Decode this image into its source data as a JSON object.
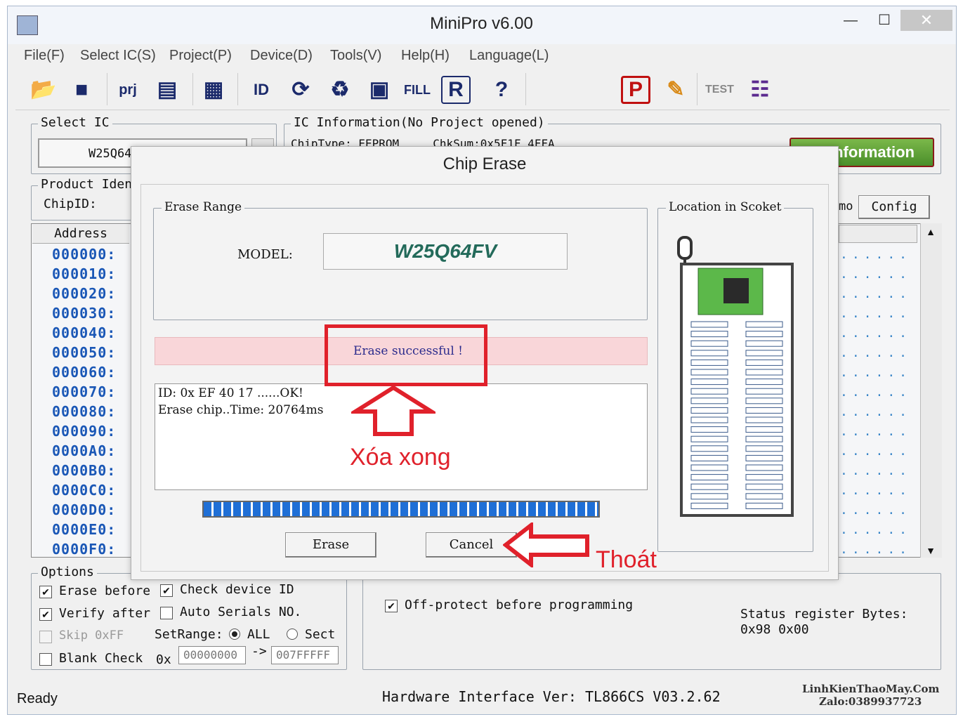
{
  "window": {
    "title": "MiniPro v6.00",
    "minimize_glyph": "—",
    "maximize_glyph": "☐",
    "close_glyph": "✕"
  },
  "menu": [
    "File(F)",
    "Select IC(S)",
    "Project(P)",
    "Device(D)",
    "Tools(V)",
    "Help(H)",
    "Language(L)"
  ],
  "toolbar_icons": [
    "open-folder-icon",
    "save-icon",
    "open-project-icon",
    "save-project-icon",
    "chip-list-icon",
    "read-id-icon",
    "read-icon",
    "verify-icon",
    "blank-check-icon",
    "fill-icon",
    "read-chip-icon",
    "help-icon",
    "program-icon",
    "edit-icon",
    "test-icon",
    "socket-icon"
  ],
  "select_ic": {
    "label": "Select IC",
    "value": "W25Q64"
  },
  "ic_info": {
    "label": "IC Information(No Project opened)",
    "line": "ChipType: EEPROM     ChkSum:0x5F1F 4FFA",
    "info_button": "nformation"
  },
  "product": {
    "label": "Product Iden",
    "chip_id": "ChipID:"
  },
  "tabs": {
    "demo": "mo",
    "config": "Config"
  },
  "hex": {
    "address_header": "Address",
    "addresses": [
      "000000:",
      "000010:",
      "000020:",
      "000030:",
      "000040:",
      "000050:",
      "000060:",
      "000070:",
      "000080:",
      "000090:",
      "0000A0:",
      "0000B0:",
      "0000C0:",
      "0000D0:",
      "0000E0:",
      "0000F0:"
    ],
    "dot_row": "......"
  },
  "options": {
    "label": "Options",
    "erase_before": "Erase before",
    "check_device_id": "Check device ID",
    "verify_after": "Verify after",
    "auto_serials": "Auto Serials NO.",
    "skip_ff": "Skip 0xFF",
    "set_range": "SetRange:",
    "all": "ALL",
    "sect": "Sect",
    "blank_check": "Blank Check",
    "hex_prefix": "0x",
    "range_from": "00000000",
    "range_arrow": "->",
    "range_to": "007FFFFF",
    "off_protect": "Off-protect before programming",
    "status_register": "Status register Bytes:",
    "status_values": "0x98 0x00"
  },
  "statusbar": {
    "ready": "Ready",
    "hardware": "Hardware Interface Ver: TL866CS V03.2.62",
    "watermark_1": "LinhKienThaoMay.Com",
    "watermark_2": "Zalo:0389937723"
  },
  "dialog": {
    "title": "Chip Erase",
    "erase_range_label": "Erase Range",
    "model_label": "MODEL:",
    "model_value": "W25Q64FV",
    "status_message": "Erase successful !",
    "log_line_1": "ID: 0x EF 40 17 ......OK!",
    "log_line_2": "Erase chip..Time: 20764ms",
    "progress": 1.0,
    "erase_button": "Erase",
    "cancel_button": "Cancel",
    "location_label": "Location in Scoket"
  },
  "annotations": {
    "done_text": "Xóa xong",
    "exit_text": "Thoát",
    "color": "#e0212b"
  }
}
